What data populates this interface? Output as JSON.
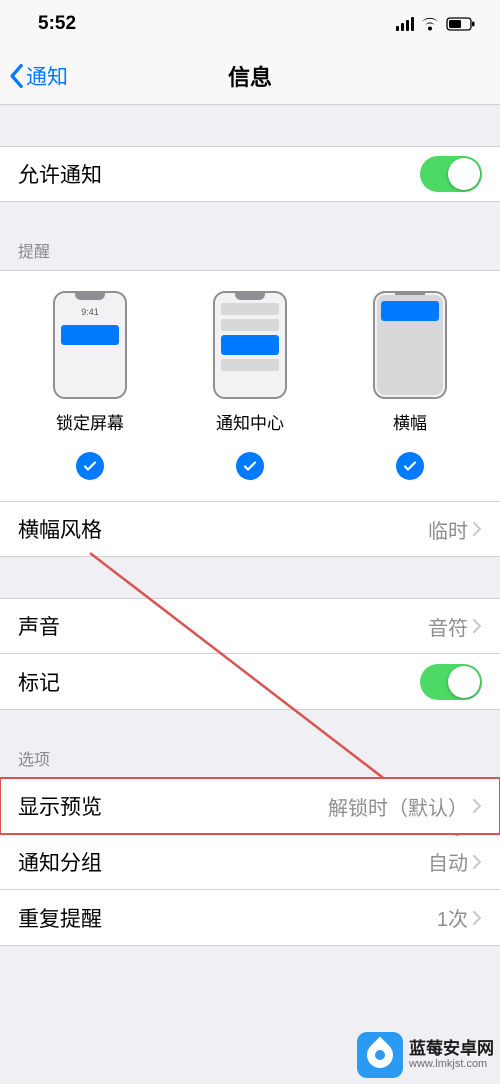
{
  "statusbar": {
    "time": "5:52"
  },
  "nav": {
    "back_label": "通知",
    "title": "信息"
  },
  "allow": {
    "label": "允许通知",
    "on": true
  },
  "alerts": {
    "header": "提醒",
    "lock_label": "锁定屏幕",
    "nc_label": "通知中心",
    "banner_label": "横幅",
    "mock_time": "9:41"
  },
  "banner_style": {
    "label": "横幅风格",
    "value": "临时"
  },
  "sound": {
    "label": "声音",
    "value": "音符"
  },
  "badge": {
    "label": "标记",
    "on": true
  },
  "options": {
    "header": "选项",
    "preview_label": "显示预览",
    "preview_value": "解锁时（默认）",
    "group_label": "通知分组",
    "group_value": "自动",
    "repeat_label": "重复提醒",
    "repeat_value": "1次"
  },
  "watermark": {
    "name": "蓝莓安卓网",
    "url": "www.lmkjst.com"
  }
}
